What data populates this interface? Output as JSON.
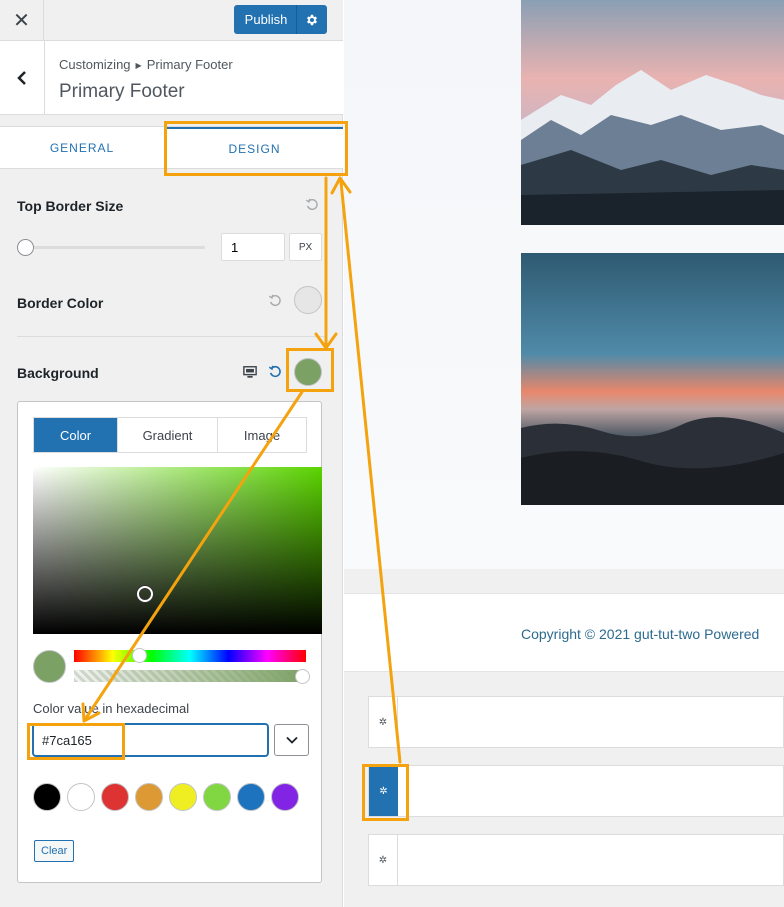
{
  "topbar": {
    "close_label": "✕",
    "publish_label": "Publish",
    "publish_menu_icon": "gear-icon"
  },
  "header": {
    "breadcrumb_root": "Customizing",
    "breadcrumb_current": "Primary Footer",
    "title": "Primary Footer"
  },
  "tabs": [
    {
      "label": "GENERAL",
      "active": false
    },
    {
      "label": "DESIGN",
      "active": true
    }
  ],
  "controls": {
    "top_border": {
      "label": "Top Border Size",
      "value": "1",
      "unit": "PX",
      "slider_fraction": 0
    },
    "border_color": {
      "label": "Border Color",
      "color": "#e6e6e6"
    },
    "background": {
      "label": "Background",
      "color": "#7ca165",
      "device_icon": "desktop-icon",
      "reset_icon": "undo-icon"
    }
  },
  "picker": {
    "tabs": [
      "Color",
      "Gradient",
      "Image"
    ],
    "hex_label": "Color value in hexadecimal",
    "hex_value": "#7ca165",
    "swatches": [
      "#000000",
      "#ffffff",
      "#dd3333",
      "#dd9933",
      "#eeee22",
      "#81d742",
      "#1e73be",
      "#8224e3"
    ],
    "clear_label": "Clear"
  },
  "preview": {
    "copyright": "Copyright © 2021 gut-tut-two Powered",
    "row_icon": "gear-icon"
  },
  "colors": {
    "accent": "#2271b1",
    "highlight": "#f4a30f"
  }
}
